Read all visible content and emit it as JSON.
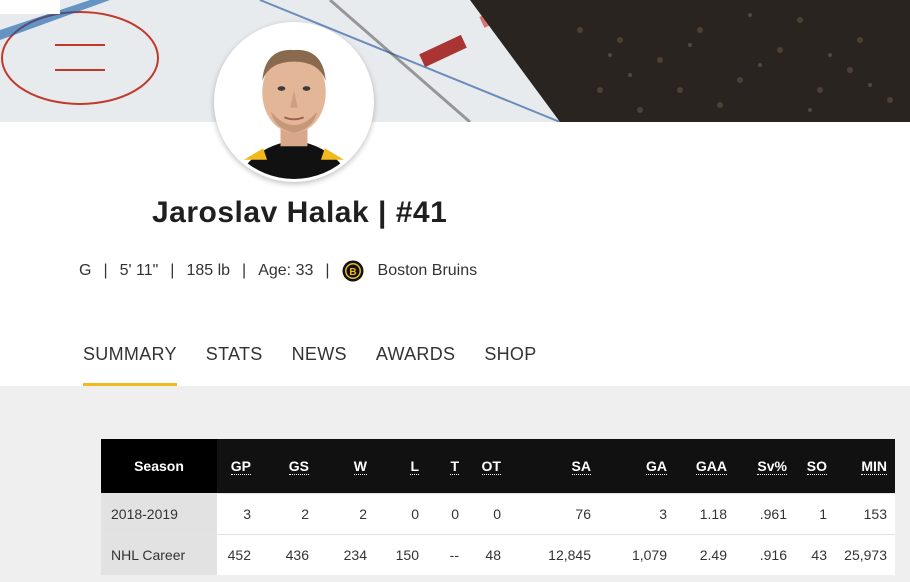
{
  "player": {
    "name_line": "Jaroslav Halak | #41",
    "bio": {
      "position": "G",
      "height": "5' 11\"",
      "weight": "185 lb",
      "age": "Age: 33",
      "team": "Boston Bruins",
      "separator": "|"
    }
  },
  "tabs": [
    {
      "label": "SUMMARY",
      "active": true
    },
    {
      "label": "STATS",
      "active": false
    },
    {
      "label": "NEWS",
      "active": false
    },
    {
      "label": "AWARDS",
      "active": false
    },
    {
      "label": "SHOP",
      "active": false
    }
  ],
  "stats_table": {
    "columns": [
      "Season",
      "GP",
      "GS",
      "W",
      "L",
      "T",
      "OT",
      "SA",
      "GA",
      "GAA",
      "Sv%",
      "SO",
      "MIN"
    ],
    "rows": [
      [
        "2018-2019",
        "3",
        "2",
        "2",
        "0",
        "0",
        "0",
        "76",
        "3",
        "1.18",
        ".961",
        "1",
        "153"
      ],
      [
        "NHL Career",
        "452",
        "436",
        "234",
        "150",
        "--",
        "48",
        "12,845",
        "1,079",
        "2.49",
        ".916",
        "43",
        "25,973"
      ]
    ]
  },
  "colors": {
    "accent": "#f1b91c",
    "table_header_bg": "#111111",
    "page_bg": "#efefef"
  },
  "icons": {
    "team_logo": "bruins-logo-icon",
    "avatar": "player-headshot"
  }
}
